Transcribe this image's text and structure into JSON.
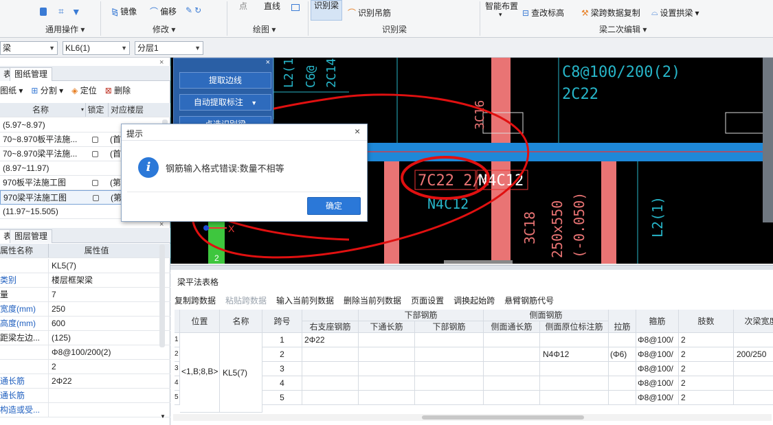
{
  "ribbon": {
    "general_ops_label": "通用操作",
    "modify_label": "修改",
    "mirror": "镜像",
    "offset": "偏移",
    "draw_label": "绘图",
    "point": "点",
    "line": "直线",
    "identify_beam_group": "识别梁",
    "identify_beam_btn": "识别梁",
    "identify_hanger": "识别吊筋",
    "smart_layout": "智能布置",
    "check_labels": "查改标高",
    "beam_span_copy": "梁跨数据复制",
    "set_arch_beam": "设置拱梁",
    "beam_secondary_edit": "梁二次编辑"
  },
  "combos": {
    "first": "梁",
    "second": "KL6(1)",
    "third": "分层1"
  },
  "drawing_panel": {
    "tab_partial": "表",
    "tab_drawing_mgmt": "图纸管理",
    "btn_drawing": "图纸",
    "btn_split": "分割",
    "btn_locate": "定位",
    "btn_delete": "删除",
    "col_name": "名称",
    "col_lock": "锁定",
    "col_floor": "对应楼层",
    "rows": [
      {
        "name": "(5.97~8.97)",
        "lock": false,
        "floor": ""
      },
      {
        "name": "70~8.970板平法施...",
        "lock": true,
        "floor": "(首"
      },
      {
        "name": "70~8.970梁平法施...",
        "lock": true,
        "floor": "(首"
      },
      {
        "name": "(8.97~11.97)",
        "lock": false,
        "floor": ""
      },
      {
        "name": "970板平法施工图",
        "lock": true,
        "floor": "(第"
      },
      {
        "name": "970梁平法施工图",
        "lock": true,
        "floor": "(第"
      },
      {
        "name": "(11.97~15.505)",
        "lock": false,
        "floor": ""
      }
    ]
  },
  "property_panel": {
    "tab_partial": "表",
    "tab_layer_mgmt": "图层管理",
    "col_name": "属性名称",
    "col_value": "属性值",
    "rows": [
      {
        "name": "",
        "value": "KL5(7)",
        "blue": false
      },
      {
        "name": "类别",
        "value": "楼层框架梁",
        "blue": true
      },
      {
        "name": "量",
        "value": "7",
        "blue": false
      },
      {
        "name": "宽度(mm)",
        "value": "250",
        "blue": true
      },
      {
        "name": "高度(mm)",
        "value": "600",
        "blue": true
      },
      {
        "name": "距梁左边...",
        "value": "(125)",
        "blue": false
      },
      {
        "name": "",
        "value": "Φ8@100/200(2)",
        "blue": false
      },
      {
        "name": "",
        "value": "2",
        "blue": false
      },
      {
        "name": "通长筋",
        "value": "2Φ22",
        "blue": true
      },
      {
        "name": "通长筋",
        "value": "",
        "blue": true
      },
      {
        "name": "构造或受...",
        "value": "",
        "blue": true
      }
    ]
  },
  "canvas": {
    "tool_extract_edge": "提取边线",
    "tool_auto_extract": "自动提取标注",
    "tool_partial": "点选识别梁",
    "texts": {
      "stirrup": "C8@100/200(2)",
      "top_bars": "2C22",
      "c16": "3C16",
      "l2_top": "L2(1",
      "c6a": "C6@",
      "c14": "2C14",
      "label_a": "7C22 2/4",
      "label_b": "N4C12",
      "label_c": "N4C12",
      "c18": "3C18",
      "size": "250x550",
      "elev": "(-0.050)",
      "l2_right": "L2(1)",
      "num2": "2",
      "axis_x": "X"
    }
  },
  "beam_table": {
    "title": "梁平法表格",
    "toolbar": [
      "复制跨数据",
      "粘贴跨数据",
      "输入当前列数据",
      "删除当前列数据",
      "页面设置",
      "调换起始跨",
      "悬臂钢筋代号"
    ],
    "headers": {
      "position": "位置",
      "name": "名称",
      "span": "跨号",
      "right_support": "右支座钢筋",
      "bottom_group": "下部钢筋",
      "bottom_through": "下通长筋",
      "bottom_bar": "下部钢筋",
      "side_group": "侧面钢筋",
      "side_through": "侧面通长筋",
      "side_orig": "侧面原位标注筋",
      "tie": "拉筋",
      "stirrup": "箍筋",
      "legs": "肢数",
      "sec_beam": "次梁宽度"
    },
    "position_value": "<1,B;8,B>",
    "name_value": "KL5(7)",
    "rows": [
      {
        "idx": "1",
        "span": "1",
        "right_support": "2Φ22",
        "side_orig": "",
        "tie": "",
        "stirrup": "Φ8@100/",
        "legs": "2",
        "sec": ""
      },
      {
        "idx": "2",
        "span": "2",
        "right_support": "",
        "side_orig": "N4Φ12",
        "tie": "(Φ6)",
        "stirrup": "Φ8@100/",
        "legs": "2",
        "sec": "200/250"
      },
      {
        "idx": "3",
        "span": "3",
        "right_support": "",
        "side_orig": "",
        "tie": "",
        "stirrup": "Φ8@100/",
        "legs": "2",
        "sec": ""
      },
      {
        "idx": "4",
        "span": "4",
        "right_support": "",
        "side_orig": "",
        "tie": "",
        "stirrup": "Φ8@100/",
        "legs": "2",
        "sec": ""
      },
      {
        "idx": "5",
        "span": "5",
        "right_support": "",
        "side_orig": "",
        "tie": "",
        "stirrup": "Φ8@100/",
        "legs": "2",
        "sec": ""
      }
    ]
  },
  "dialog": {
    "title": "提示",
    "message": "钢筋输入格式错误:数量不相等",
    "ok": "确定"
  }
}
